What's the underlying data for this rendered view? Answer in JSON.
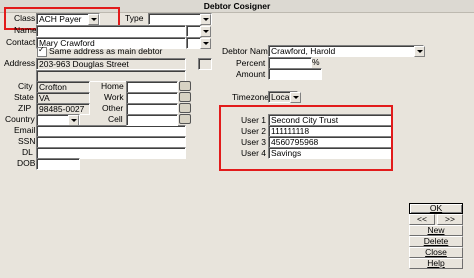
{
  "window": {
    "title": "Debtor Cosigner"
  },
  "labels": {
    "class": "Class",
    "type": "Type",
    "name": "Name",
    "contact": "Contact",
    "same_address": "Same address as main debtor",
    "address": "Address",
    "city": "City",
    "state": "State",
    "zip": "ZIP",
    "country": "Country",
    "email": "Email",
    "ssn": "SSN",
    "dl": "DL",
    "dob": "DOB",
    "home": "Home",
    "work": "Work",
    "other": "Other",
    "cell": "Cell",
    "debtor_name": "Debtor Name",
    "percent": "Percent",
    "amount": "Amount",
    "timezone": "Timezone",
    "user1": "User 1",
    "user2": "User 2",
    "user3": "User 3",
    "user4": "User 4"
  },
  "values": {
    "class": "ACH Payer",
    "type": "",
    "name": "",
    "contact": "Mary Crawford",
    "address": "203-963 Douglas Street",
    "city": "Crofton",
    "state": "VA",
    "zip": "98485-0027",
    "country": "",
    "email": "",
    "ssn": "",
    "dl": "",
    "dob": "",
    "home": "",
    "work": "",
    "other": "",
    "cell": "",
    "debtor_name": "Crawford, Harold",
    "percent": "",
    "percent_sign": "%",
    "amount": "",
    "timezone": "Local",
    "user1": "Second City Trust",
    "user2": "111111118",
    "user3": "4560795968",
    "user4": "Savings"
  },
  "buttons": {
    "ok": "OK",
    "prev": "<<",
    "next": ">>",
    "new": "New",
    "delete": "Delete",
    "close": "Close",
    "help": "Help"
  },
  "colors": {
    "highlight": "#e21b1b",
    "background": "#e8e4dc"
  },
  "icons": {
    "phone": "phone-icon",
    "dropdown": "chevron-down-icon",
    "check": "check-icon"
  }
}
